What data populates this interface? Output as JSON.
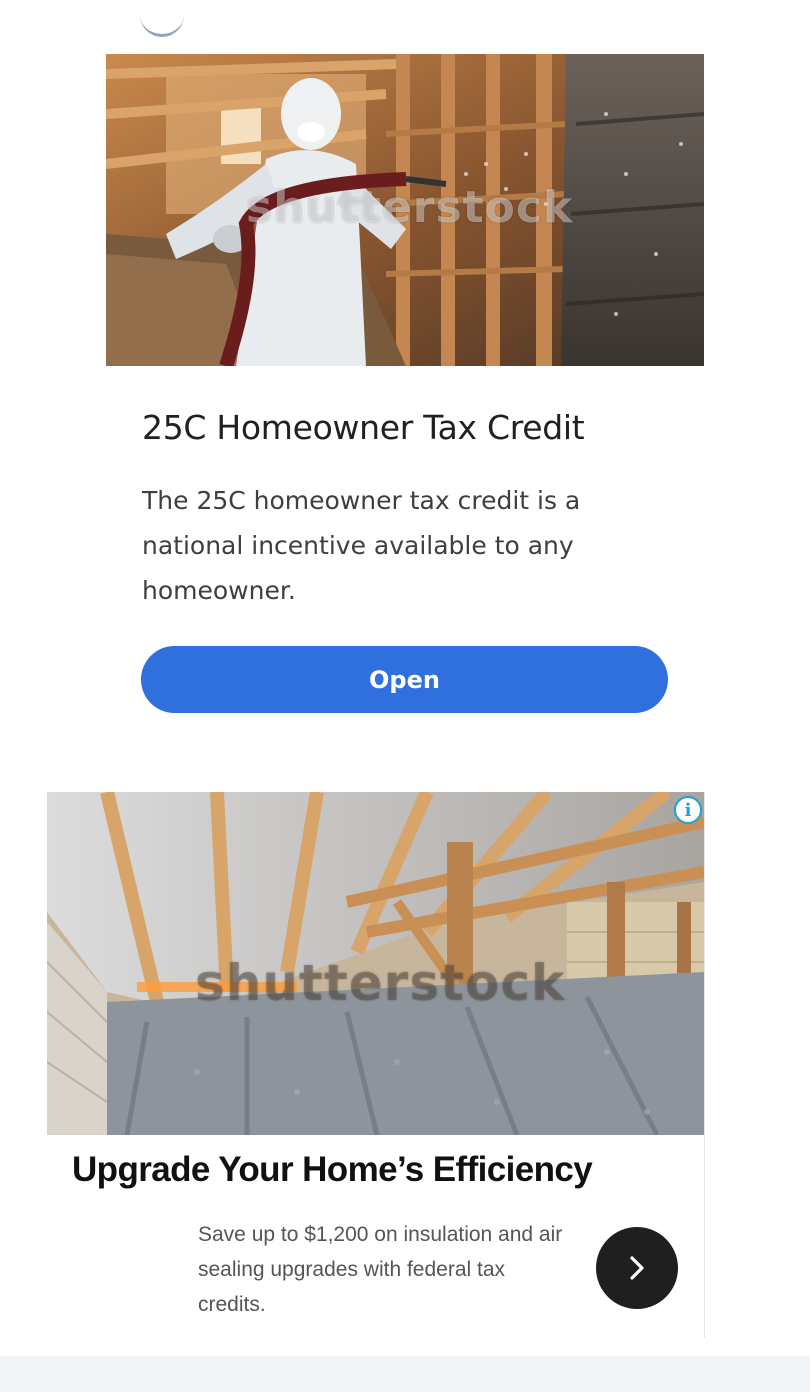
{
  "ad1": {
    "title": "25C Homeowner Tax Credit",
    "description": "The 25C homeowner tax credit is a national incentive available to any homeowner.",
    "button_label": "Open",
    "watermark": "shutterstock"
  },
  "ad2": {
    "title": "Upgrade Your Home’s Efficiency",
    "description": "Save up to $1,200 on insulation and air sealing upgrades with federal tax credits.",
    "watermark": "shutterstock",
    "info_icon": "info-icon",
    "next_icon": "chevron-right-icon"
  },
  "colors": {
    "button_blue": "#2f6fde",
    "info_blue": "#1aa3d8",
    "next_button": "#1f1f1f"
  }
}
